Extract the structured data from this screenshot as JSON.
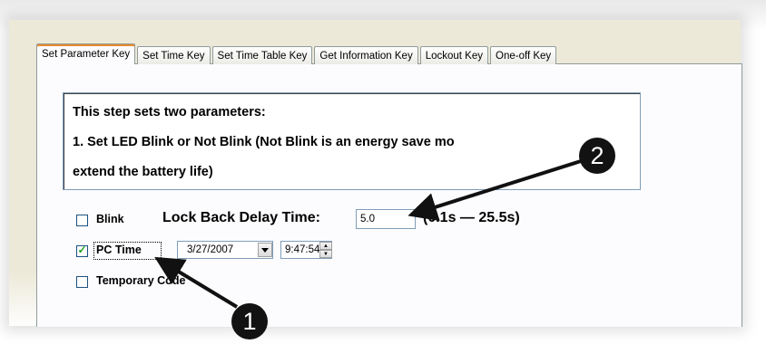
{
  "tabs": [
    {
      "label": "Set Parameter Key",
      "active": true
    },
    {
      "label": "Set Time Key"
    },
    {
      "label": "Set Time Table Key"
    },
    {
      "label": "Get Information Key"
    },
    {
      "label": "Lockout Key"
    },
    {
      "label": "One-off Key"
    }
  ],
  "description": {
    "line1": "This step sets two parameters:",
    "line2": "1. Set LED Blink or Not Blink (Not Blink is an energy save mo",
    "line3": "extend the battery life)"
  },
  "blink": {
    "label": "Blink",
    "checked": false
  },
  "lock_back": {
    "label": "Lock Back Delay Time:",
    "value": "5.0",
    "range": "(0.1s — 25.5s)"
  },
  "pc_time": {
    "label": "PC Time",
    "checked": true,
    "date": "3/27/2007",
    "time": "9:47:54"
  },
  "temporary_code": {
    "label": "Temporary Code",
    "checked": false
  },
  "callouts": [
    {
      "number": "1"
    },
    {
      "number": "2"
    }
  ],
  "colors": {
    "panel": "#ece9d8",
    "tab_accent": "#e68b2c",
    "check": "#21a121",
    "badge": "#121212"
  }
}
